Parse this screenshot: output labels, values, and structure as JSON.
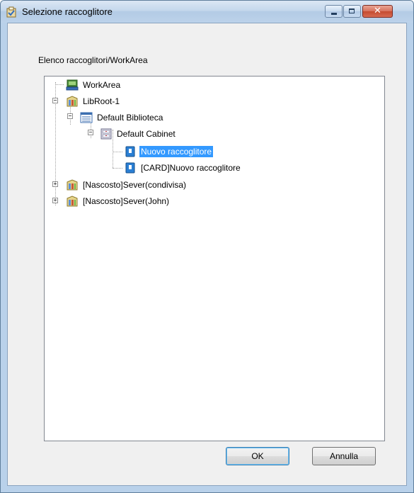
{
  "window": {
    "title": "Selezione raccoglitore",
    "controls": {
      "minimize": "minimize",
      "maximize": "maximize",
      "close": "✕"
    }
  },
  "tree_label": "Elenco raccoglitori/WorkArea",
  "tree": {
    "nodes": [
      {
        "label": "WorkArea",
        "icon": "workarea-icon"
      },
      {
        "label": "LibRoot-1",
        "icon": "library-icon",
        "expander": "−"
      },
      {
        "label": "Default Biblioteca",
        "icon": "bookshelf-icon",
        "expander": "−"
      },
      {
        "label": "Default Cabinet",
        "icon": "cabinet-icon",
        "expander": "−"
      },
      {
        "label": "Nuovo raccoglitore",
        "icon": "binder-icon",
        "selected": true
      },
      {
        "label": "[CARD]Nuovo raccoglitore",
        "icon": "binder-icon"
      },
      {
        "label": "[Nascosto]Sever(condivisa)",
        "icon": "library-icon",
        "expander": "+"
      },
      {
        "label": "[Nascosto]Sever(John)",
        "icon": "library-icon",
        "expander": "+"
      }
    ]
  },
  "buttons": {
    "ok": "OK",
    "cancel": "Annulla"
  },
  "colors": {
    "selection": "#3399ff",
    "title_bar": "#c4d7ec",
    "close_button": "#c44a2f"
  }
}
